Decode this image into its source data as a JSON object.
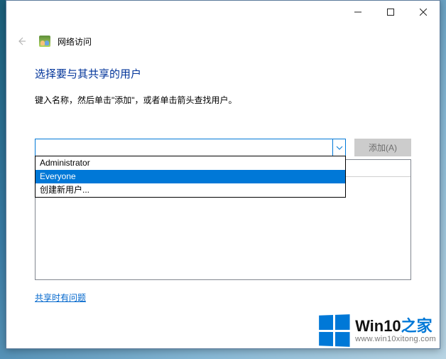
{
  "breadcrumb": {
    "title": "网络访问"
  },
  "heading": "选择要与其共享的用户",
  "instruction": "键入名称，然后单击\"添加\"，或者单击箭头查找用户。",
  "combo": {
    "value": "",
    "placeholder": ""
  },
  "add_button": {
    "label": "添加(A)"
  },
  "dropdown": {
    "items": [
      {
        "label": "Administrator",
        "selected": false
      },
      {
        "label": "Everyone",
        "selected": true
      },
      {
        "label": "创建新用户...",
        "selected": false
      }
    ]
  },
  "help_link": "共享时有问题",
  "watermark": {
    "brand_prefix": "Win10",
    "brand_suffix": "之家",
    "url": "www.win10xitong.com"
  }
}
